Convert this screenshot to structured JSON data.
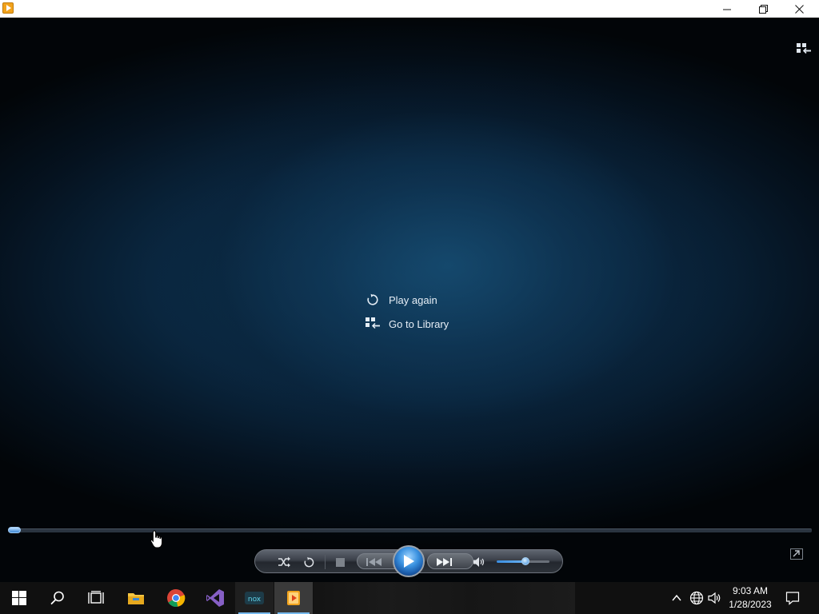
{
  "window": {
    "app_icon": "windows-media-player-icon",
    "controls": {
      "minimize": "minimize-icon",
      "maximize": "restore-icon",
      "close": "close-icon"
    }
  },
  "player": {
    "menu": {
      "play_again": "Play again",
      "go_to_library": "Go to Library"
    },
    "seek_progress": 0.0,
    "volume_level": 0.55
  },
  "controls": {
    "shuffle": "shuffle-icon",
    "repeat": "repeat-icon",
    "stop": "stop-icon",
    "previous": "previous-icon",
    "play": "play-icon",
    "next": "next-icon",
    "mute": "speaker-icon"
  },
  "taskbar": {
    "pinned": [
      "start-icon",
      "search-icon",
      "task-view-icon",
      "file-explorer-icon",
      "chrome-icon",
      "visual-studio-icon",
      "nox-icon",
      "windows-media-player-icon"
    ],
    "time": "9:03 AM",
    "date": "1/28/2023"
  },
  "colors": {
    "accent": "#76b9ed",
    "play_button": "#3b92e0",
    "background_glow": "#0f3a5a"
  }
}
